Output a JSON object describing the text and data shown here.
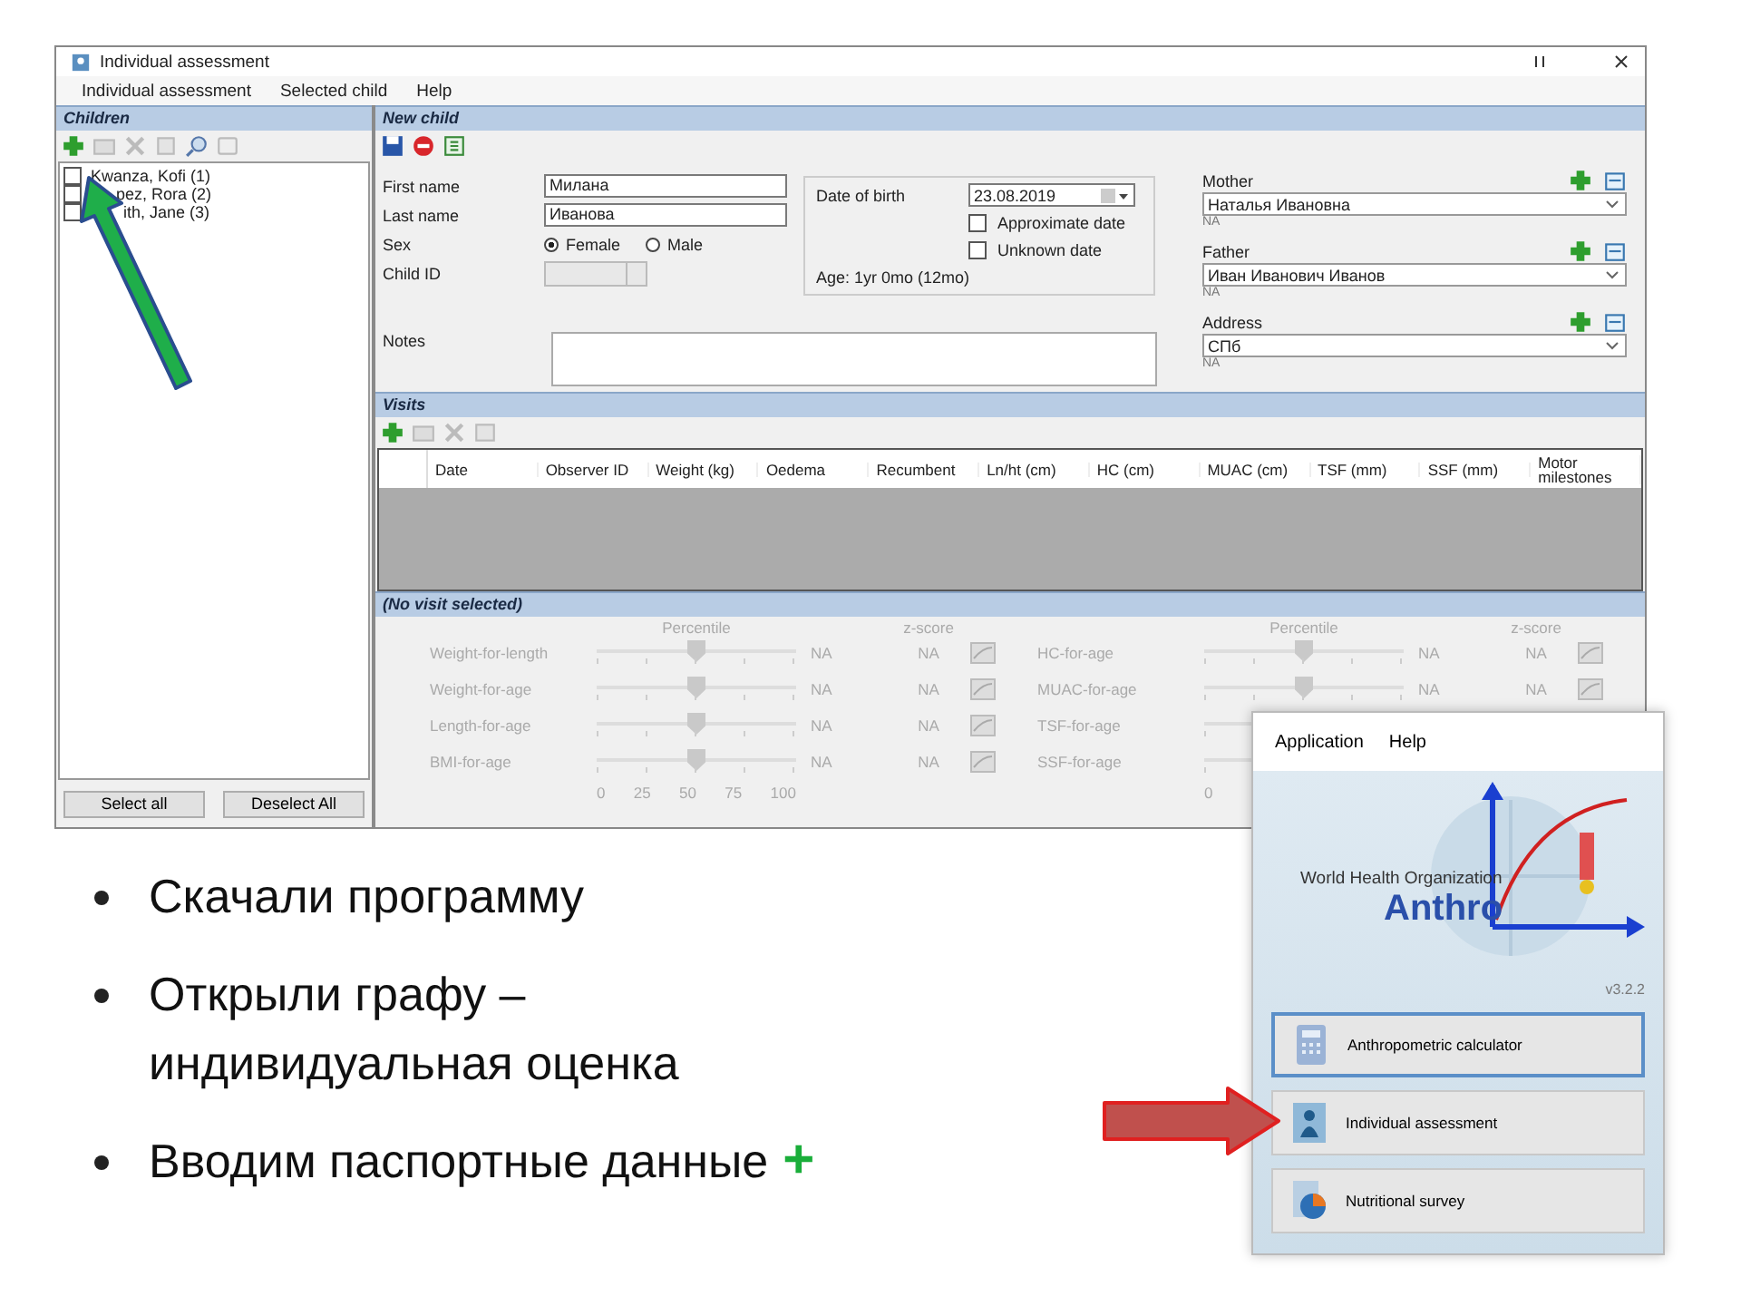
{
  "window": {
    "title": "Individual assessment"
  },
  "menu": [
    "Individual assessment",
    "Selected child",
    "Help"
  ],
  "children_panel": {
    "header": "Children",
    "items": [
      {
        "label": "Kwanza, Kofi (1)",
        "checked": false
      },
      {
        "label": "pez, Rora (2)",
        "checked": false
      },
      {
        "label": "ith, Jane (3)",
        "checked": false
      }
    ],
    "buttons": [
      "Select all",
      "Deselect All"
    ]
  },
  "child_form": {
    "header": "New child",
    "fields": [
      {
        "label": "First name",
        "value": "Милана"
      },
      {
        "label": "Last name",
        "value": "Иванова"
      }
    ],
    "sex": {
      "label": "Sex",
      "options": [
        {
          "label": "Female",
          "selected": true
        },
        {
          "label": "Male",
          "selected": false
        }
      ]
    },
    "child_id": {
      "label": "Child ID"
    },
    "notes": {
      "label": "Notes"
    },
    "date_of_birth": {
      "label": "Date of birth",
      "value": "23.08.2019"
    },
    "date_options": [
      {
        "label": "Approximate date",
        "checked": false
      },
      {
        "label": "Unknown date",
        "checked": false
      }
    ],
    "age": "Age: 1yr 0mo (12mo)",
    "relations": [
      {
        "label": "Mother",
        "value": "Наталья Ивановна",
        "note": "NA"
      },
      {
        "label": "Father",
        "value": "Иван Иванович Иванов",
        "note": "NA"
      },
      {
        "label": "Address",
        "value": "СПб",
        "note": "NA"
      }
    ]
  },
  "visits": {
    "header": "Visits",
    "columns": [
      "Date",
      "Observer ID",
      "Weight (kg)",
      "Oedema",
      "Recumbent",
      "Ln/ht (cm)",
      "HC (cm)",
      "MUAC (cm)",
      "TSF (mm)",
      "SSF (mm)",
      "Motor milestones"
    ]
  },
  "details": {
    "header": "(No visit selected)",
    "groups": [
      {
        "percentile_label": "Percentile",
        "zscore_label": "z-score",
        "axis": [
          "0",
          "25",
          "50",
          "75",
          "100"
        ],
        "rows": [
          {
            "label": "Weight-for-length",
            "level": 0.5,
            "percentile": "NA",
            "zscore": "NA"
          },
          {
            "label": "Weight-for-age",
            "level": 0.5,
            "percentile": "NA",
            "zscore": "NA"
          },
          {
            "label": "Length-for-age",
            "level": 0.5,
            "percentile": "NA",
            "zscore": "NA"
          },
          {
            "label": "BMI-for-age",
            "level": 0.5,
            "percentile": "NA",
            "zscore": "NA"
          }
        ]
      },
      {
        "percentile_label": "Percentile",
        "zscore_label": "z-score",
        "axis": [
          "0"
        ],
        "rows": [
          {
            "label": "HC-for-age",
            "level": 0.5,
            "percentile": "NA",
            "zscore": "NA"
          },
          {
            "label": "MUAC-for-age",
            "level": 0.5,
            "percentile": "NA",
            "zscore": "NA"
          },
          {
            "label": "TSF-for-age"
          },
          {
            "label": "SSF-for-age"
          }
        ]
      }
    ]
  },
  "launcher": {
    "menu": [
      "Application",
      "Help"
    ],
    "logo_caption": "World Health Organization",
    "logo_title": "Anthro",
    "version": "v3.2.2",
    "buttons": [
      {
        "label": "Anthropometric calculator",
        "kind": "calculator",
        "selected": true
      },
      {
        "label": "Individual assessment",
        "kind": "person",
        "selected": false
      },
      {
        "label": "Nutritional survey",
        "kind": "survey",
        "selected": false
      }
    ]
  },
  "slide": {
    "bullets": [
      {
        "text": "Скачали программу"
      },
      {
        "text": "Открыли графу – индивидуальная оценка"
      },
      {
        "text": "Вводим паспортные данные",
        "mark": "+"
      }
    ]
  }
}
